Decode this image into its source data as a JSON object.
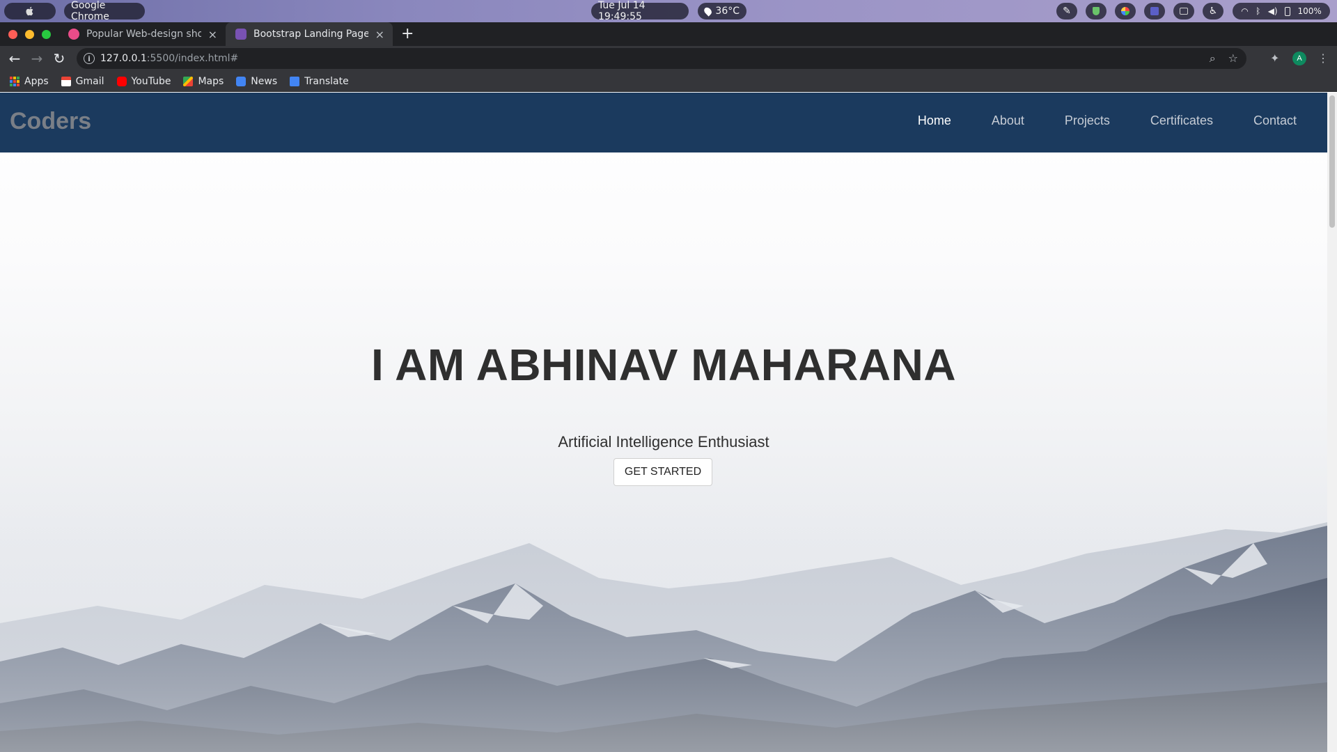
{
  "system_bar": {
    "app_name": "Google Chrome",
    "datetime": "Tue Jul 14  19:49:55",
    "weather": "36°C",
    "battery": "100%",
    "icons": [
      "apple-icon",
      "pen-icon",
      "shield-icon",
      "palette-icon",
      "teams-icon",
      "screen-icon",
      "accessibility-icon",
      "wifi-icon",
      "bluetooth-icon",
      "volume-icon",
      "battery-icon"
    ]
  },
  "tabs": [
    {
      "title": "Popular Web-design shot",
      "active": false,
      "favicon_color": "#ea4c89"
    },
    {
      "title": "Bootstrap Landing Page",
      "active": true,
      "favicon_color": "#7952b3"
    }
  ],
  "toolbar": {
    "url_host": "127.0.0.1",
    "url_rest": ":5500/index.html#",
    "profile_initial": "A"
  },
  "bookmarks": [
    {
      "label": "Apps",
      "icon": "apps-grid-icon"
    },
    {
      "label": "Gmail",
      "icon": "gmail-icon"
    },
    {
      "label": "YouTube",
      "icon": "youtube-icon"
    },
    {
      "label": "Maps",
      "icon": "maps-icon"
    },
    {
      "label": "News",
      "icon": "news-icon"
    },
    {
      "label": "Translate",
      "icon": "translate-icon"
    }
  ],
  "site": {
    "brand": "Coders",
    "nav": [
      "Home",
      "About",
      "Projects",
      "Certificates",
      "Contact"
    ],
    "active_nav": "Home",
    "hero_title": "I AM ABHINAV MAHARANA",
    "hero_subtitle": "Artificial Intelligence Enthusiast",
    "cta_label": "GET STARTED"
  },
  "colors": {
    "navbar": "#1b3a5e",
    "brand_text": "#7a7f87",
    "chrome_dark": "#202124",
    "chrome_toolbar": "#35363a"
  }
}
